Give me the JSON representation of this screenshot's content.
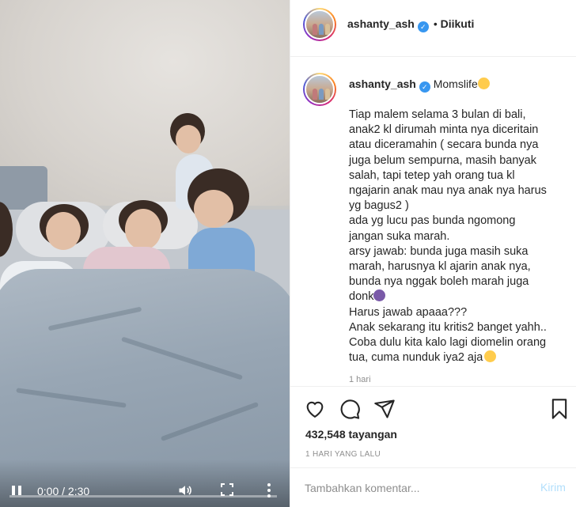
{
  "post": {
    "username": "ashanty_ash",
    "verified_mark": "✓",
    "follow_separator": "•",
    "follow_status": "Diikuti"
  },
  "caption": {
    "username": "ashanty_ash",
    "first_text": "Momslife",
    "lines": [
      "Tiap malem selama 3 bulan di bali,",
      "anak2 kl dirumah minta nya diceritain",
      "atau diceramahin ( secara bunda nya",
      "juga belum sempurna, masih banyak",
      "salah, tapi tetep yah orang tua kl",
      "ngajarin anak mau nya anak nya harus",
      "yg bagus2 )",
      "ada yg lucu pas bunda ngomong",
      "jangan suka marah.",
      "arsy jawab: bunda juga masih suka",
      "marah, harusnya kl ajarin anak nya,",
      "bunda nya nggak boleh marah juga",
      "donk",
      "Harus jawab apaaa???",
      "Anak sekarang itu kritis2 banget yahh..",
      "Coba dulu kita kalo lagi diomelin orang",
      "tua, cuma nunduk iya2 aja"
    ],
    "time": "1 hari"
  },
  "video": {
    "time_display": "0:00 / 2:30",
    "progress": 0.0
  },
  "actions": {
    "icons": [
      "heart-icon",
      "comment-icon",
      "share-icon",
      "bookmark-icon"
    ],
    "views": "432,548 tayangan",
    "date": "1 HARI YANG LALU"
  },
  "comment": {
    "placeholder": "Tambahkan komentar...",
    "post_label": "Kirim"
  },
  "colors": {
    "verified": "#3897f0",
    "post_button_disabled": "#b2dffc",
    "secondary_text": "#8e8e8e"
  }
}
